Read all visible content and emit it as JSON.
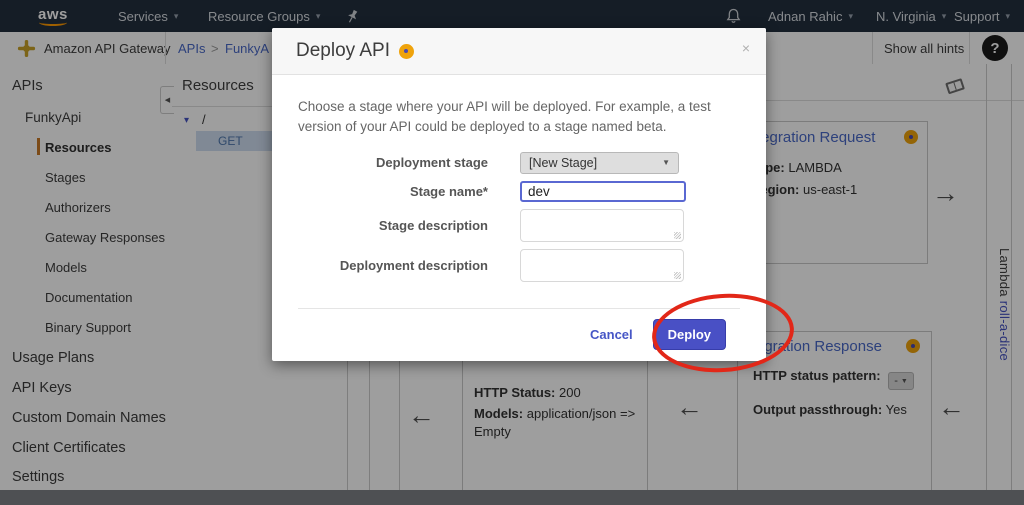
{
  "topnav": {
    "logo": "aws",
    "services": "Services",
    "resource_groups": "Resource Groups",
    "user": "Adnan Rahic",
    "region": "N. Virginia",
    "support": "Support"
  },
  "subheader": {
    "app_name": "Amazon API Gateway",
    "breadcrumb_apis": "APIs",
    "breadcrumb_sep": ">",
    "breadcrumb_api": "FunkyA",
    "show_hints": "Show all hints",
    "help_glyph": "?"
  },
  "sidebar": {
    "items": [
      {
        "label": "APIs"
      },
      {
        "label": "FunkyApi"
      },
      {
        "label": "Resources"
      },
      {
        "label": "Stages"
      },
      {
        "label": "Authorizers"
      },
      {
        "label": "Gateway Responses"
      },
      {
        "label": "Models"
      },
      {
        "label": "Documentation"
      },
      {
        "label": "Binary Support"
      },
      {
        "label": "Usage Plans"
      },
      {
        "label": "API Keys"
      },
      {
        "label": "Custom Domain Names"
      },
      {
        "label": "Client Certificates"
      },
      {
        "label": "Settings"
      }
    ]
  },
  "resources_panel": {
    "title": "Resources",
    "root_path": "/",
    "method": "GET"
  },
  "content": {
    "integration_request": {
      "title": "tegration Request",
      "type_label": "Type:",
      "type_value": "LAMBDA",
      "region_label": "Region:",
      "region_value": "us-east-1"
    },
    "method_response": {
      "http_status_label": "HTTP Status:",
      "http_status_value": "200",
      "models_label": "Models:",
      "models_value_line1": "application/json =>",
      "models_value_line2": "Empty"
    },
    "integration_response": {
      "title": "egration Response",
      "pattern_label": "HTTP status pattern:",
      "pattern_value": "-",
      "passthrough_label": "Output passthrough:",
      "passthrough_value": "Yes"
    },
    "lambda_strip": {
      "prefix": "Lambda ",
      "link": "roll-a-dice"
    }
  },
  "modal": {
    "title": "Deploy API",
    "description": "Choose a stage where your API will be deployed. For example, a test version of your API could be deployed to a stage named beta.",
    "fields": {
      "deployment_stage": {
        "label": "Deployment stage",
        "value": "[New Stage]"
      },
      "stage_name": {
        "label": "Stage name*",
        "value": "dev"
      },
      "stage_description": {
        "label": "Stage description",
        "value": ""
      },
      "deployment_description": {
        "label": "Deployment description",
        "value": ""
      }
    },
    "cancel_label": "Cancel",
    "deploy_label": "Deploy"
  },
  "icons": {
    "caret_down": "▾",
    "collapse_left": "◀",
    "select_caret": "▼",
    "arrow_right": "→",
    "arrow_left": "←",
    "close": "×",
    "tree_caret": "▾"
  },
  "colors": {
    "nav_bg": "#232f3e",
    "accent_button": "#4950c5",
    "link_blue": "#4a69c8",
    "hint_orange": "#efa30c",
    "annotation_red": "#e22718",
    "active_item_orange": "#c97a28"
  }
}
